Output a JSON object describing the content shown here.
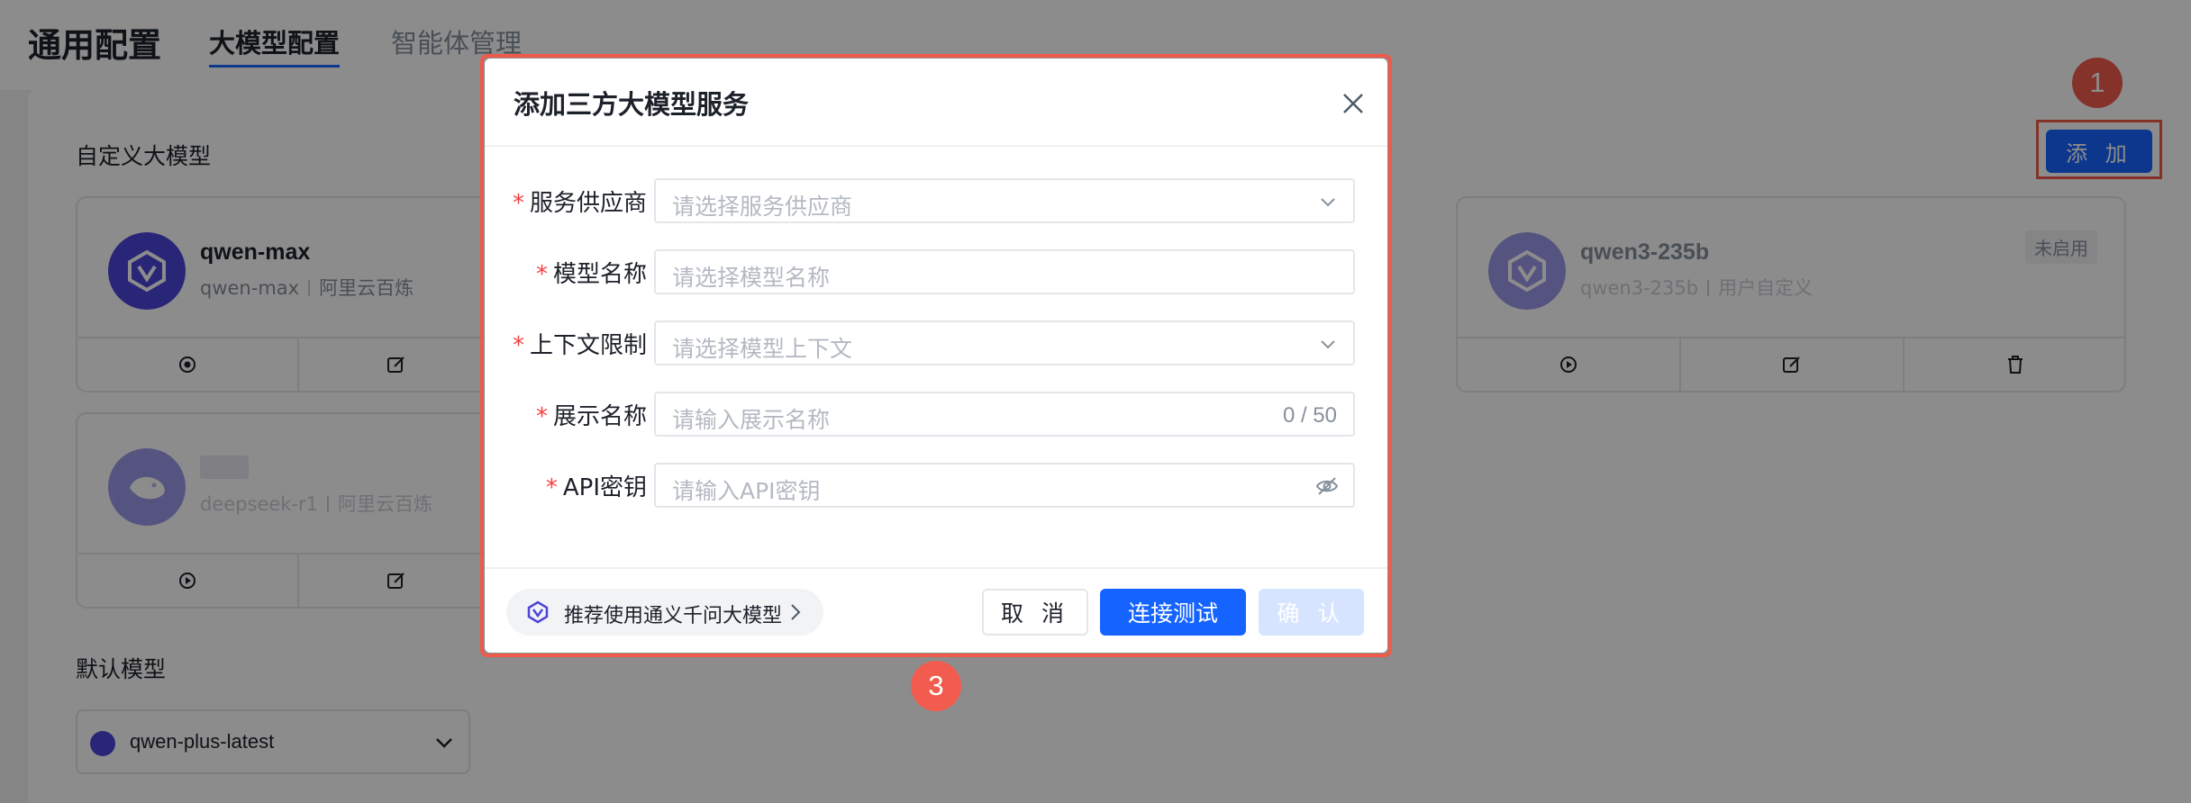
{
  "header": {
    "title": "通用配置",
    "tabs": [
      {
        "label": "大模型配置",
        "active": true
      },
      {
        "label": "智能体管理",
        "active": false
      }
    ]
  },
  "custom_models": {
    "section_title": "自定义大模型",
    "add_label": "添 加",
    "cards": [
      {
        "name": "qwen-max",
        "model_id": "qwen-max",
        "provider": "阿里云百炼",
        "status": ""
      },
      {
        "name": "qwen3-235b",
        "model_id": "qwen3-235b",
        "provider": "用户自定义",
        "status": "未启用"
      },
      {
        "name": "",
        "model_id": "deepseek-r1",
        "provider": "阿里云百炼",
        "status": ""
      }
    ]
  },
  "default_model": {
    "section_title": "默认模型",
    "selected": "qwen-plus-latest"
  },
  "annotations": {
    "badge_1": "1",
    "badge_3": "3"
  },
  "modal": {
    "title": "添加三方大模型服务",
    "fields": [
      {
        "label": "服务供应商",
        "placeholder": "请选择服务供应商",
        "type": "select"
      },
      {
        "label": "模型名称",
        "placeholder": "请选择模型名称",
        "type": "input"
      },
      {
        "label": "上下文限制",
        "placeholder": "请选择模型上下文",
        "type": "select"
      },
      {
        "label": "展示名称",
        "placeholder": "请输入展示名称",
        "type": "input",
        "counter": "0 / 50"
      },
      {
        "label": "API密钥",
        "placeholder": "请输入API密钥",
        "type": "password"
      }
    ],
    "required_mark": "*",
    "recommend_text": "推荐使用通义千问大模型",
    "buttons": {
      "cancel": "取 消",
      "test": "连接测试",
      "confirm": "确 认"
    }
  },
  "colors": {
    "primary": "#1664ff",
    "annotation_red": "#f25c4e",
    "required": "#f53f3f",
    "avatar": "#4d46d9"
  }
}
